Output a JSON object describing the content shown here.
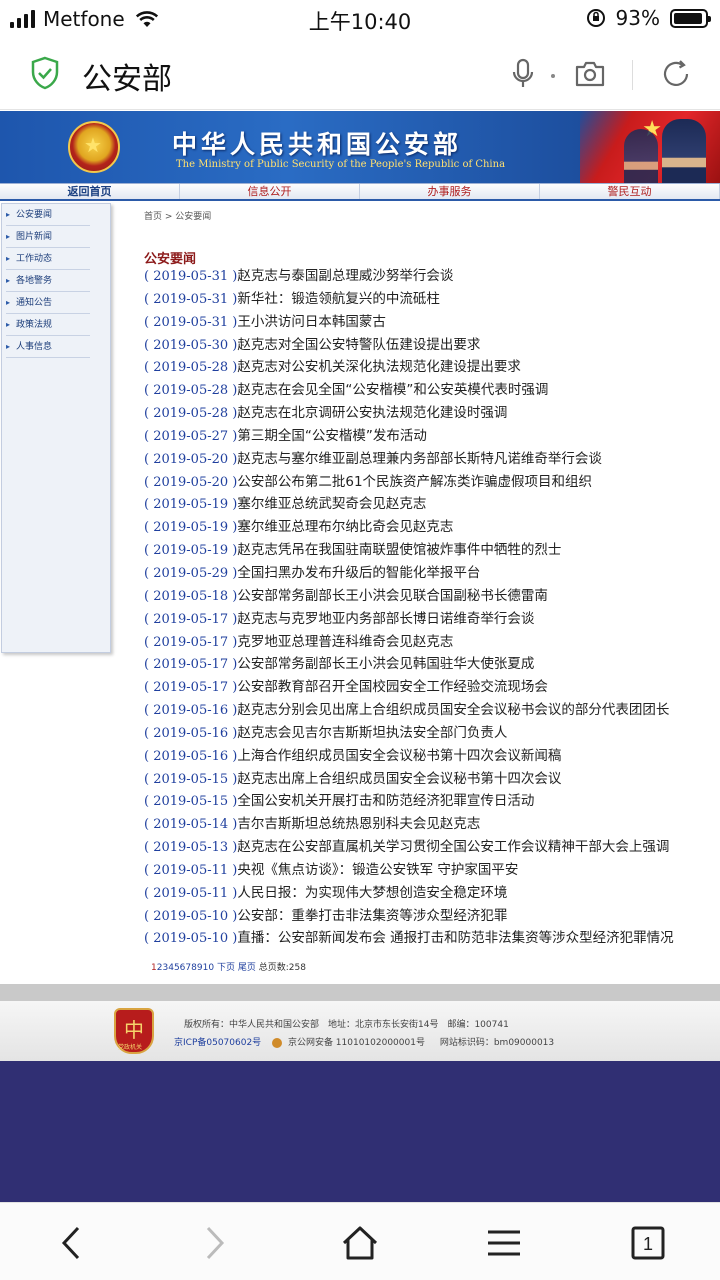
{
  "status_bar": {
    "carrier": "Metfone",
    "time": "上午10:40",
    "battery_percent": "93%",
    "battery_level": 0.93
  },
  "address_bar": {
    "title": "公安部"
  },
  "banner": {
    "title_cn": "中华人民共和国公安部",
    "title_en": "The Ministry of Public Security of the People's Republic of China"
  },
  "nav": [
    {
      "label": "返回首页"
    },
    {
      "label": "信息公开"
    },
    {
      "label": "办事服务"
    },
    {
      "label": "警民互动"
    }
  ],
  "sidebar": [
    {
      "label": "公安要闻"
    },
    {
      "label": "图片新闻"
    },
    {
      "label": "工作动态"
    },
    {
      "label": "各地警务"
    },
    {
      "label": "通知公告"
    },
    {
      "label": "政策法规"
    },
    {
      "label": "人事信息"
    }
  ],
  "breadcrumb": "首页 > 公安要闻",
  "section_title": "公安要闻",
  "news": [
    {
      "date": "( 2019-05-31 )",
      "title": "赵克志与泰国副总理威沙努举行会谈"
    },
    {
      "date": "( 2019-05-31 )",
      "title": "新华社：锻造领航复兴的中流砥柱"
    },
    {
      "date": "( 2019-05-31 )",
      "title": "王小洪访问日本韩国蒙古"
    },
    {
      "date": "( 2019-05-30 )",
      "title": "赵克志对全国公安特警队伍建设提出要求"
    },
    {
      "date": "( 2019-05-28 )",
      "title": "赵克志对公安机关深化执法规范化建设提出要求"
    },
    {
      "date": "( 2019-05-28 )",
      "title": "赵克志在会见全国“公安楷模”和公安英模代表时强调"
    },
    {
      "date": "( 2019-05-28 )",
      "title": "赵克志在北京调研公安执法规范化建设时强调"
    },
    {
      "date": "( 2019-05-27 )",
      "title": "第三期全国“公安楷模”发布活动"
    },
    {
      "date": "( 2019-05-20 )",
      "title": "赵克志与塞尔维亚副总理兼内务部部长斯特凡诺维奇举行会谈"
    },
    {
      "date": "( 2019-05-20 )",
      "title": "公安部公布第二批61个民族资产解冻类诈骗虚假项目和组织"
    },
    {
      "date": "( 2019-05-19 )",
      "title": "塞尔维亚总统武契奇会见赵克志"
    },
    {
      "date": "( 2019-05-19 )",
      "title": "塞尔维亚总理布尔纳比奇会见赵克志"
    },
    {
      "date": "( 2019-05-19 )",
      "title": "赵克志凭吊在我国驻南联盟使馆被炸事件中牺牲的烈士"
    },
    {
      "date": "( 2019-05-29 )",
      "title": "全国扫黑办发布升级后的智能化举报平台"
    },
    {
      "date": "( 2019-05-18 )",
      "title": "公安部常务副部长王小洪会见联合国副秘书长德雷南"
    },
    {
      "date": "( 2019-05-17 )",
      "title": "赵克志与克罗地亚内务部部长博日诺维奇举行会谈"
    },
    {
      "date": "( 2019-05-17 )",
      "title": "克罗地亚总理普连科维奇会见赵克志"
    },
    {
      "date": "( 2019-05-17 )",
      "title": "公安部常务副部长王小洪会见韩国驻华大使张夏成"
    },
    {
      "date": "( 2019-05-17 )",
      "title": "公安部教育部召开全国校园安全工作经验交流现场会"
    },
    {
      "date": "( 2019-05-16 )",
      "title": "赵克志分别会见出席上合组织成员国安全会议秘书会议的部分代表团团长"
    },
    {
      "date": "( 2019-05-16 )",
      "title": "赵克志会见吉尔吉斯斯坦执法安全部门负责人"
    },
    {
      "date": "( 2019-05-16 )",
      "title": "上海合作组织成员国安全会议秘书第十四次会议新闻稿"
    },
    {
      "date": "( 2019-05-15 )",
      "title": "赵克志出席上合组织成员国安全会议秘书第十四次会议"
    },
    {
      "date": "( 2019-05-15 )",
      "title": "全国公安机关开展打击和防范经济犯罪宣传日活动"
    },
    {
      "date": "( 2019-05-14 )",
      "title": "吉尔吉斯斯坦总统热恩别科夫会见赵克志"
    },
    {
      "date": "( 2019-05-13 )",
      "title": "赵克志在公安部直属机关学习贯彻全国公安工作会议精神干部大会上强调"
    },
    {
      "date": "( 2019-05-11 )",
      "title": "央视《焦点访谈》：锻造公安铁军 守护家国平安"
    },
    {
      "date": "( 2019-05-11 )",
      "title": "人民日报：为实现伟大梦想创造安全稳定环境"
    },
    {
      "date": "( 2019-05-10 )",
      "title": "公安部：重拳打击非法集资等涉众型经济犯罪"
    },
    {
      "date": "( 2019-05-10 )",
      "title": "直播：公安部新闻发布会 通报打击和防范非法集资等涉众型经济犯罪情况"
    }
  ],
  "pagination": {
    "pages": [
      "1",
      "2",
      "3",
      "4",
      "5",
      "6",
      "7",
      "8",
      "9",
      "10"
    ],
    "next": "下页",
    "last": "尾页",
    "total": "总页数:258"
  },
  "footer": {
    "logo_text": "党政机关",
    "copyright": "版权所有：中华人民共和国公安部　地址：北京市东长安街14号　邮编：100741",
    "icp": "京ICP备05070602号",
    "police_record": "京公网安备 11010102000001号",
    "site_id": "网站标识码：bm09000013"
  }
}
